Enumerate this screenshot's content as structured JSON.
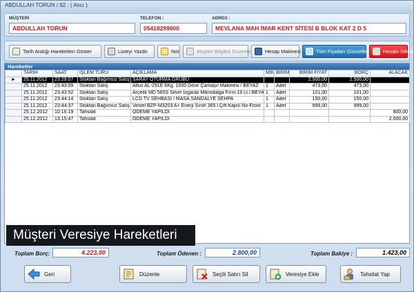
{
  "window": {
    "title": "ABDULLAH TORUN / 92 : ( Alıcı )"
  },
  "info": {
    "customer_label": "MÜŞTERİ",
    "customer_value": "ABDULLAH TORUN",
    "phone_label": "TELEFON :",
    "phone_value": "05418299600",
    "address_label": "ADRES :",
    "address_value": "MEVLANA MAH İMAR KENT SİTESİ B BLOK KAT 2 D 5"
  },
  "toolbar": {
    "date_range": "Tarih Aralığı Hareketleri Göster",
    "print_list": "Listeyi Yazdır",
    "note": "Not",
    "edit_customer": "Müşteri Bilgileri Düzenle",
    "calculator": "Hesap Makinesi",
    "update_prices": "Tüm Fiyatları Güncelle",
    "reset_account": "Hesabı Sıfırla"
  },
  "grid": {
    "title": "Hareketler",
    "columns": [
      "TARİH",
      "SAAT",
      "İŞLEM TÜRÜ",
      "AÇIKLAMA",
      "MİK",
      "BİRİM",
      "BİRİM FİYAT",
      "BORÇ",
      "ALACAK"
    ],
    "rows": [
      [
        "25.11.2012",
        "23:29:07",
        "Stoktan Bağımsız Satış",
        "SARAY OTURMA GRUBU",
        "",
        "",
        "2.500,00",
        "2.500,00",
        ""
      ],
      [
        "25.11.2012",
        "23:43:09",
        "Stoktan Satış",
        "Altus AL-291E 6Kg. 1000 Devir Çamaşır Makinesi / BEYAZ",
        "1",
        "Adet",
        "473,00",
        "473,00",
        ""
      ],
      [
        "25.11.2012",
        "23:43:52",
        "Stoktan Satış",
        "Arçelik MD 565S Silver Izgaralı Mikrodalga Fırın-19 Lt / BEYAZ",
        "1",
        "Adet",
        "101,00",
        "101,00",
        ""
      ],
      [
        "25.11.2012",
        "23:44:14",
        "Stoktan Satış",
        "LCD TV SEHBASI / MASA SANDALYE SEHPA",
        "1",
        "Adet",
        "150,00",
        "150,00",
        ""
      ],
      [
        "25.11.2012",
        "23:44:37",
        "Stoktan Bağımsız Satış",
        "Vestel BZP-M3203 A+ Enerji Sınıfı 365 l Çift Kapılı No-Frost",
        "1",
        "Adet",
        "999,00",
        "999,00",
        ""
      ],
      [
        "25.12.2012",
        "10:16:19",
        "Tahsilat",
        "ÖDEME YAPILDI",
        "",
        "",
        "",
        "",
        "800,00"
      ],
      [
        "25.12.2012",
        "13:15:47",
        "Tahsilat",
        "ÖDEME YAPILDI",
        "",
        "",
        "",
        "",
        "2.000,00"
      ]
    ]
  },
  "banner": {
    "text": "Müşteri Veresiye Hareketleri"
  },
  "totals": {
    "debt_label": "Toplam Borç:",
    "debt_value": "4.223,00",
    "paid_label": "Toplam Ödenen :",
    "paid_value": "2.800,00",
    "balance_label": "Toplam Bakiye :",
    "balance_value": "1.423,00"
  },
  "bottom": {
    "back": "Geri",
    "edit": "Düzenle",
    "delete_row": "Seçili Satırı Sil",
    "add_credit": "Veresiye Ekle",
    "collect": "Tahsilat Yap"
  },
  "colors": {
    "accent": "#2c66a8",
    "debt": "#d8141c",
    "paid": "#1f3fbf",
    "balance": "#000000"
  }
}
